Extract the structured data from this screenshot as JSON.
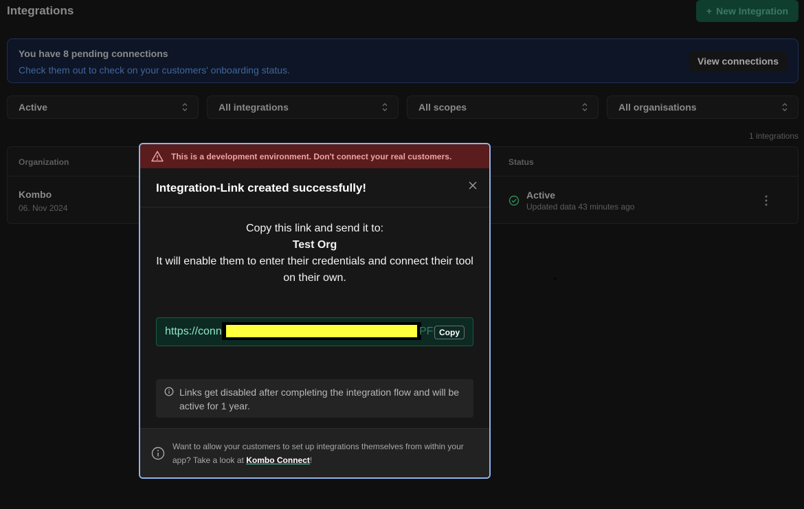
{
  "header": {
    "title": "Integrations",
    "new_button": "New Integration"
  },
  "banner": {
    "title": "You have 8 pending connections",
    "subtitle": "Check them out to check on your customers' onboarding status.",
    "button": "View connections"
  },
  "filters": [
    "Active",
    "All integrations",
    "All scopes",
    "All organisations"
  ],
  "table": {
    "count": "1 integrations",
    "columns": {
      "organization": "Organization",
      "status": "Status"
    },
    "row": {
      "org": "Kombo",
      "date": "06. Nov 2024",
      "status": "Active",
      "status_sub": "Updated data 43 minutes ago"
    }
  },
  "modal": {
    "dev_warning": "This is a development environment. Don't connect your real customers.",
    "title": "Integration-Link created successfully!",
    "msg_line1": "Copy this link and send it to:",
    "org": "Test Org",
    "msg_line2": "It will enable them to enter their credentials and connect their tool on their own.",
    "link_start": "https://conn",
    "link_tail": "PFF",
    "copy": "Copy",
    "info": "Links get disabled after completing the integration flow and will be active for 1 year.",
    "footer_text": "Want to allow your customers to set up integrations themselves from within your app? Take a look at",
    "footer_link": "Kombo Connect",
    "footer_end": "!"
  },
  "colors": {
    "accent": "#4fd1a5",
    "modal_border": "#8fb4ec",
    "danger_bg": "#5a1c1c"
  }
}
